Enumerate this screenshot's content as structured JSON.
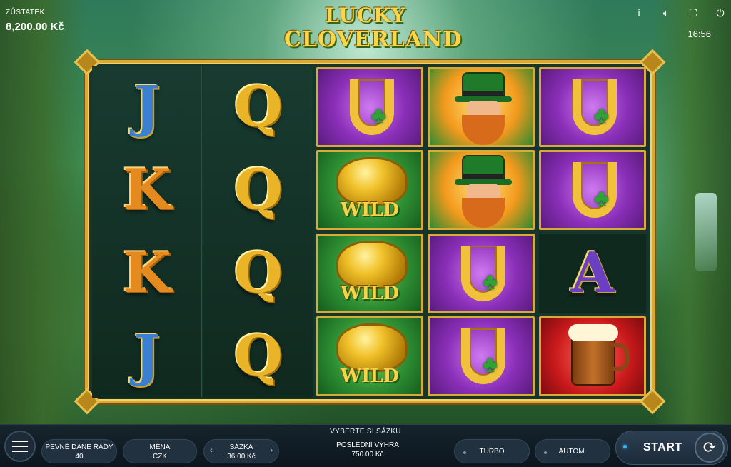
{
  "balance": {
    "label": "ZŮSTATEK",
    "value": "8,200.00 Kč"
  },
  "logo": {
    "line1": "LUCKY",
    "line2": "CLOVERLAND"
  },
  "top_controls": {
    "info_icon": "i",
    "sound_icon": "speaker-icon",
    "fullscreen_icon": "fullscreen-icon",
    "power_icon": "power-icon",
    "clock": "16:56"
  },
  "reels": [
    [
      "J",
      "K",
      "K",
      "J"
    ],
    [
      "Q",
      "Q",
      "Q",
      "Q"
    ],
    [
      "horseshoe",
      "wild",
      "wild",
      "wild"
    ],
    [
      "leprechaun",
      "leprechaun",
      "horseshoe",
      "horseshoe"
    ],
    [
      "horseshoe",
      "horseshoe",
      "A",
      "mug"
    ]
  ],
  "symbols": {
    "wild_label": "WILD"
  },
  "bottom_bar": {
    "prompt": "VYBERTE SI SÁZKU",
    "lines": {
      "label": "PEVNĚ DANÉ ŘADY",
      "value": "40"
    },
    "currency": {
      "label": "MĚNA",
      "value": "CZK"
    },
    "bet": {
      "label": "SÁZKA",
      "value": "36.00 Kč",
      "dec": "‹",
      "inc": "›"
    },
    "last_win": {
      "label": "POSLEDNÍ VÝHRA",
      "value": "750.00 Kč"
    },
    "turbo": "TURBO",
    "auto": "AUTOM.",
    "start": "START",
    "spin_icon": "⟳"
  }
}
